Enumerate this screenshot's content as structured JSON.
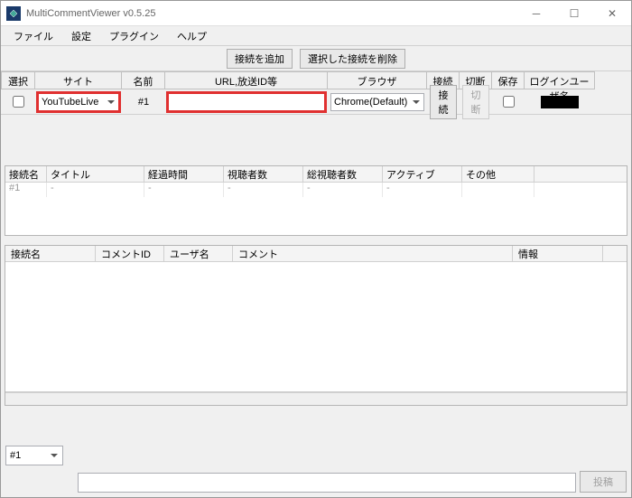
{
  "window": {
    "title": "MultiCommentViewer v0.5.25"
  },
  "menu": {
    "file": "ファイル",
    "settings": "設定",
    "plugin": "プラグイン",
    "help": "ヘルプ"
  },
  "toolbar": {
    "add": "接続を追加",
    "del": "選択した接続を削除"
  },
  "conn_head": {
    "select": "選択",
    "site": "サイト",
    "name": "名前",
    "url": "URL,放送ID等",
    "browser": "ブラウザ",
    "connect": "接続",
    "disconnect": "切断",
    "save": "保存",
    "user": "ログインユーザ名"
  },
  "conn_row": {
    "site": "YouTubeLive",
    "name": "#1",
    "url": "",
    "browser": "Chrome(Default)",
    "connect": "接続",
    "disconnect": "切断"
  },
  "stat_head": {
    "name": "接続名",
    "title": "タイトル",
    "elapsed": "経過時間",
    "viewers": "視聴者数",
    "total": "総視聴者数",
    "active": "アクティブ",
    "other": "その他"
  },
  "stat_row": {
    "name": "#1",
    "title": "-",
    "elapsed": "-",
    "viewers": "-",
    "total": "-",
    "active": "-",
    "other": ""
  },
  "cm_head": {
    "name": "接続名",
    "id": "コメントID",
    "user": "ユーザ名",
    "comment": "コメント",
    "info": "情報"
  },
  "footer": {
    "target": "#1",
    "post": "投稿"
  }
}
